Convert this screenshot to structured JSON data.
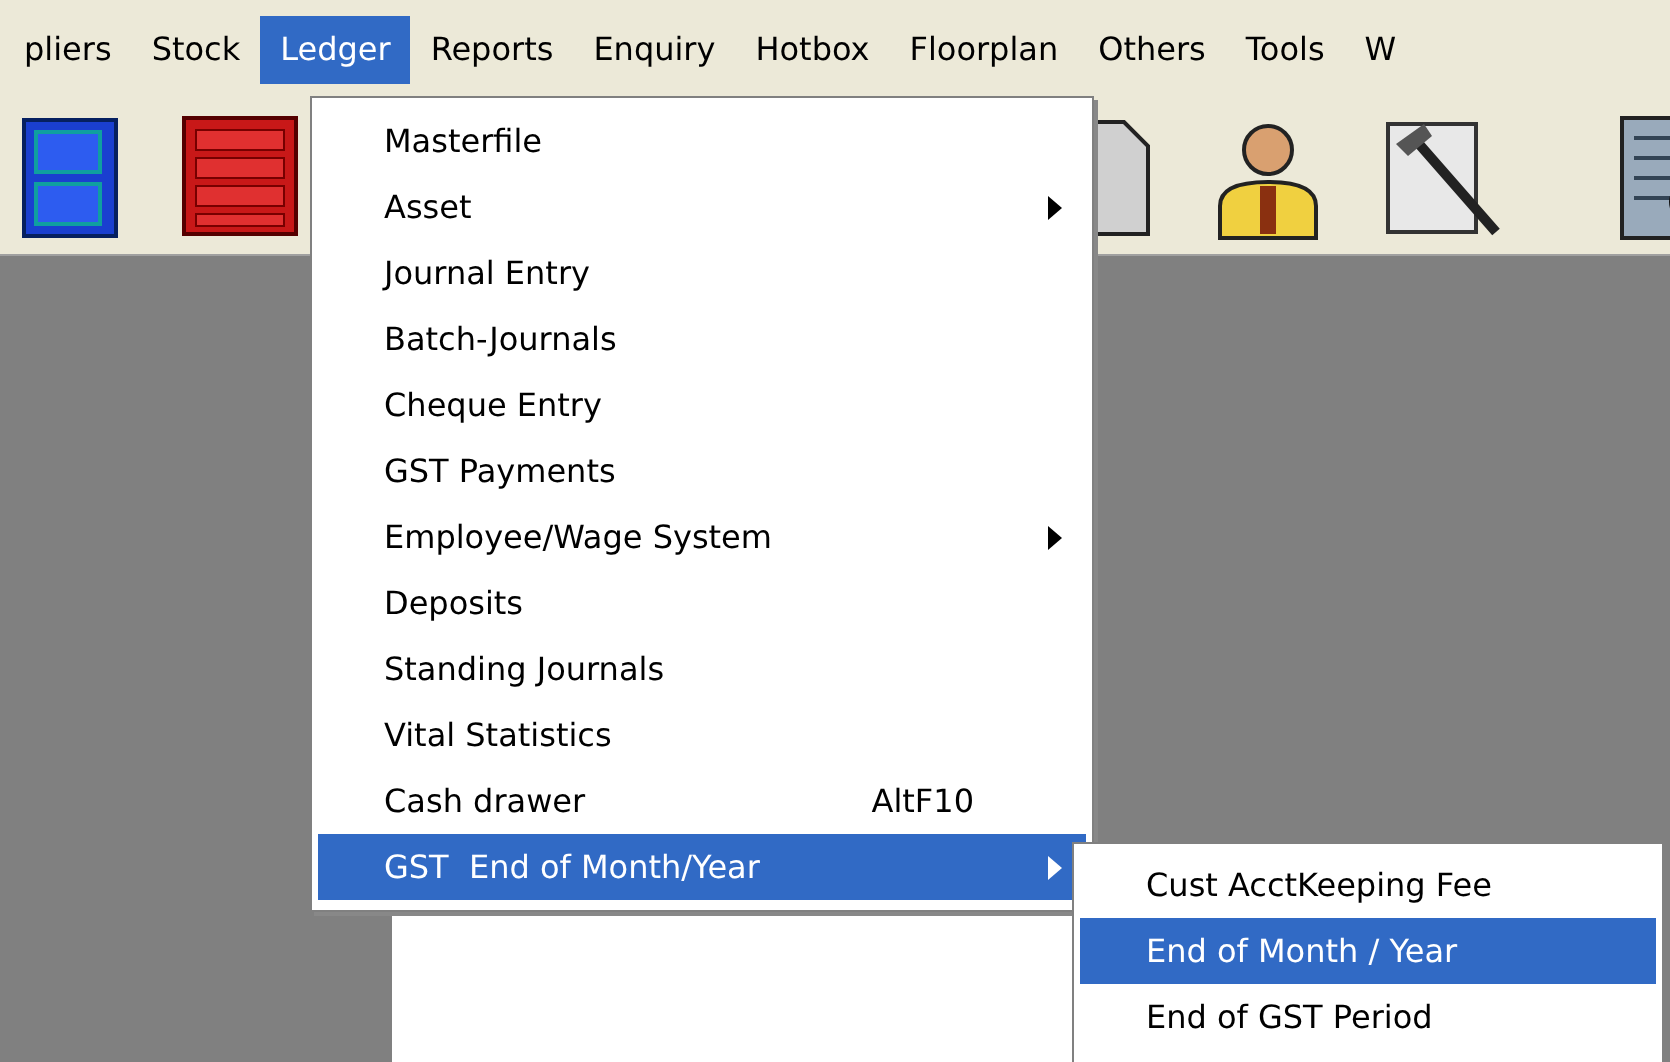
{
  "menu_bar": [
    {
      "label": "pliers",
      "selected": false
    },
    {
      "label": "Stock",
      "selected": false
    },
    {
      "label": "Ledger",
      "selected": true
    },
    {
      "label": "Reports",
      "selected": false
    },
    {
      "label": "Enquiry",
      "selected": false
    },
    {
      "label": "Hotbox",
      "selected": false
    },
    {
      "label": "Floorplan",
      "selected": false
    },
    {
      "label": "Others",
      "selected": false
    },
    {
      "label": "Tools",
      "selected": false
    },
    {
      "label": "W",
      "selected": false
    }
  ],
  "ledger_menu": [
    {
      "label": "Masterfile",
      "submenu": false,
      "selected": false
    },
    {
      "label": "Asset",
      "submenu": true,
      "selected": false
    },
    {
      "label": "Journal Entry",
      "submenu": false,
      "selected": false
    },
    {
      "label": "Batch-Journals",
      "submenu": false,
      "selected": false
    },
    {
      "label": "Cheque Entry",
      "submenu": false,
      "selected": false
    },
    {
      "label": "GST Payments",
      "submenu": false,
      "selected": false
    },
    {
      "label": "Employee/Wage System",
      "submenu": true,
      "selected": false
    },
    {
      "label": "Deposits",
      "submenu": false,
      "selected": false
    },
    {
      "label": "Standing Journals",
      "submenu": false,
      "selected": false
    },
    {
      "label": "Vital Statistics",
      "submenu": false,
      "selected": false
    },
    {
      "label": "Cash drawer",
      "shortcut": "AltF10",
      "submenu": false,
      "selected": false
    },
    {
      "label": "GST  End of Month/Year",
      "submenu": true,
      "selected": true
    }
  ],
  "submenu": [
    {
      "label": "Cust AcctKeeping Fee",
      "selected": false
    },
    {
      "label": "End of Month / Year",
      "selected": true
    },
    {
      "label": "End of GST Period",
      "selected": false
    }
  ]
}
